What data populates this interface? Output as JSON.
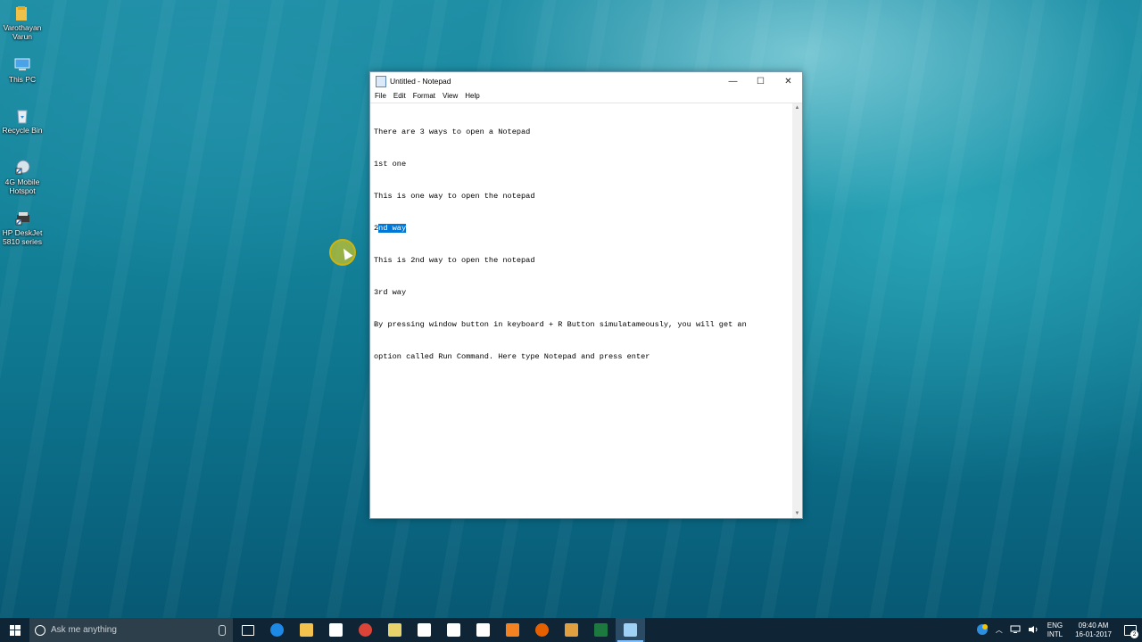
{
  "desktop": {
    "icons": [
      {
        "label_line1": "Varothayan",
        "label_line2": "Varun",
        "icon": "user-folder-icon"
      },
      {
        "label_line1": "This PC",
        "label_line2": "",
        "icon": "computer-icon"
      },
      {
        "label_line1": "Recycle Bin",
        "label_line2": "",
        "icon": "recycle-bin-icon"
      },
      {
        "label_line1": "4G Mobile",
        "label_line2": "Hotspot",
        "icon": "hotspot-shortcut-icon"
      },
      {
        "label_line1": "HP DeskJet",
        "label_line2": "5810 series",
        "icon": "printer-shortcut-icon"
      }
    ]
  },
  "notepad": {
    "title": "Untitled - Notepad",
    "menu": [
      "File",
      "Edit",
      "Format",
      "View",
      "Help"
    ],
    "lines": {
      "l1": "There are 3 ways to open a Notepad",
      "l2": "1st one",
      "l3": "This is one way to open the notepad",
      "l4_pre": "2",
      "l4_sel": "nd way",
      "l5": "This is 2nd way to open the notepad",
      "l6": "3rd way",
      "l7": "By pressing window button in keyboard + R Button simulatameously, you will get an",
      "l8": "option called Run Command. Here type Notepad and press enter"
    },
    "controls": {
      "minimize": "—",
      "maximize": "☐",
      "close": "✕"
    }
  },
  "taskbar": {
    "search_placeholder": "Ask me anything",
    "pinned": [
      {
        "name": "task-view-icon",
        "color": "#ffffff"
      },
      {
        "name": "edge-icon",
        "color": "#1e88e5"
      },
      {
        "name": "file-explorer-icon",
        "color": "#f2c14e"
      },
      {
        "name": "store-icon",
        "color": "#ffffff"
      },
      {
        "name": "chrome-icon",
        "color": "#db4437"
      },
      {
        "name": "sticky-notes-icon",
        "color": "#e8d36a"
      },
      {
        "name": "calculator-icon",
        "color": "#ffffff"
      },
      {
        "name": "camera-icon",
        "color": "#ffffff"
      },
      {
        "name": "calendar-icon",
        "color": "#ffffff"
      },
      {
        "name": "vlc-icon",
        "color": "#f58220"
      },
      {
        "name": "firefox-icon",
        "color": "#e66000"
      },
      {
        "name": "tool-icon",
        "color": "#e0a040"
      },
      {
        "name": "excel-icon",
        "color": "#1d7a3f"
      },
      {
        "name": "notepad-icon",
        "color": "#9fd0f5"
      }
    ],
    "tray": {
      "language_line1": "ENG",
      "language_line2": "INTL",
      "time": "09:40 AM",
      "date": "16-01-2017",
      "notification_count": "2"
    }
  }
}
